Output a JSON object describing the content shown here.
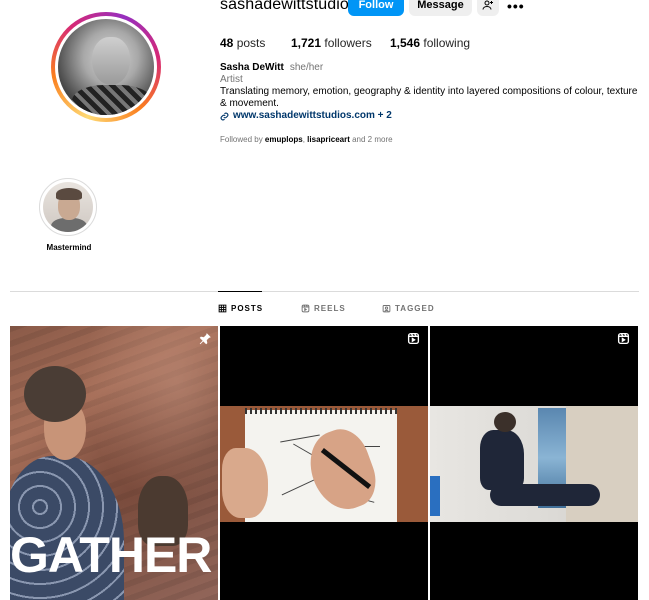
{
  "profile": {
    "username": "sashadewittstudios",
    "follow_label": "Follow",
    "message_label": "Message",
    "posts_count": "48",
    "posts_label": "posts",
    "followers_count": "1,721",
    "followers_label": "followers",
    "following_count": "1,546",
    "following_label": "following",
    "full_name": "Sasha DeWitt",
    "pronouns": "she/her",
    "category": "Artist",
    "bio": "Translating memory, emotion, geography & identity into layered compositions of colour, texture & movement.",
    "link": "www.sashadewittstudios.com + 2",
    "followed_by_prefix": "Followed by",
    "followed_by_user1": "emuplops",
    "followed_by_sep": ",",
    "followed_by_user2": "lisapriceart",
    "followed_by_suffix": "and 2 more"
  },
  "highlights": [
    {
      "label": "Mastermind"
    }
  ],
  "tabs": [
    {
      "label": "POSTS",
      "icon": "grid-icon",
      "active": true
    },
    {
      "label": "REELS",
      "icon": "reels-icon",
      "active": false
    },
    {
      "label": "TAGGED",
      "icon": "tagged-icon",
      "active": false
    }
  ],
  "posts": [
    {
      "type": "photo",
      "pinned": true,
      "overlay_text": "GATHER"
    },
    {
      "type": "reel"
    },
    {
      "type": "reel"
    }
  ],
  "colors": {
    "accent": "#0095f6",
    "link": "#00376b",
    "muted": "#737373"
  }
}
